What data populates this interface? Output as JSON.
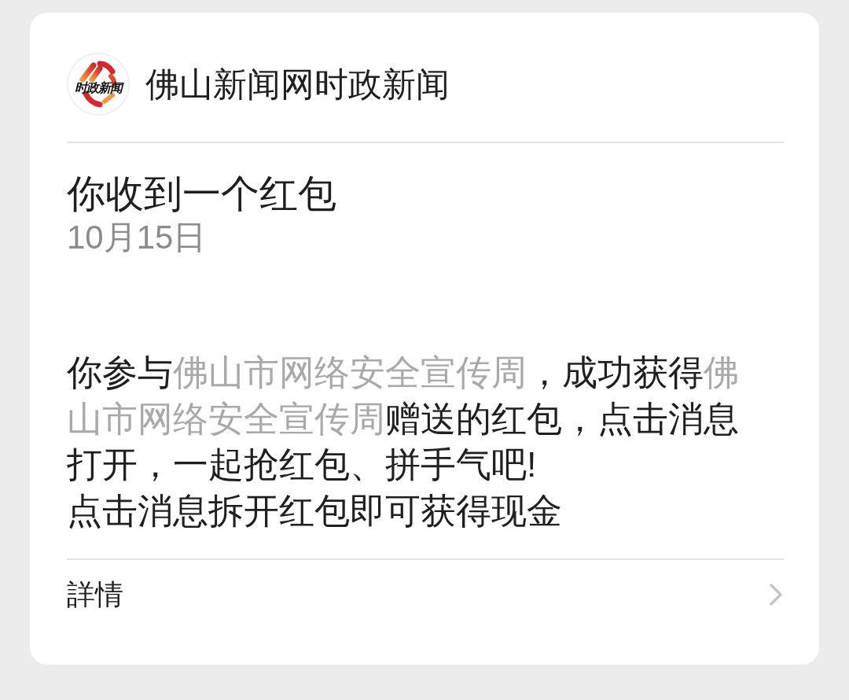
{
  "header": {
    "logo": {
      "text": "时政新闻"
    },
    "account_name": "佛山新闻网时政新闻"
  },
  "message": {
    "title": "你收到一个红包",
    "date": "10月15日",
    "paragraphs": [
      {
        "segments": [
          {
            "kind": "plain",
            "text": "你参与"
          },
          {
            "kind": "dim",
            "text": "佛山市网络安全宣传周"
          },
          {
            "kind": "plain",
            "text": "，成功获得"
          },
          {
            "kind": "dim",
            "text": "佛山市网络安全宣传周"
          },
          {
            "kind": "plain",
            "text": "赠送的红包，点击消息打开，一起抢红包、拼手气吧!"
          }
        ]
      },
      {
        "segments": [
          {
            "kind": "plain",
            "text": "点击消息拆开红包即可获得现金"
          }
        ]
      }
    ]
  },
  "footer": {
    "label": "詳情"
  }
}
